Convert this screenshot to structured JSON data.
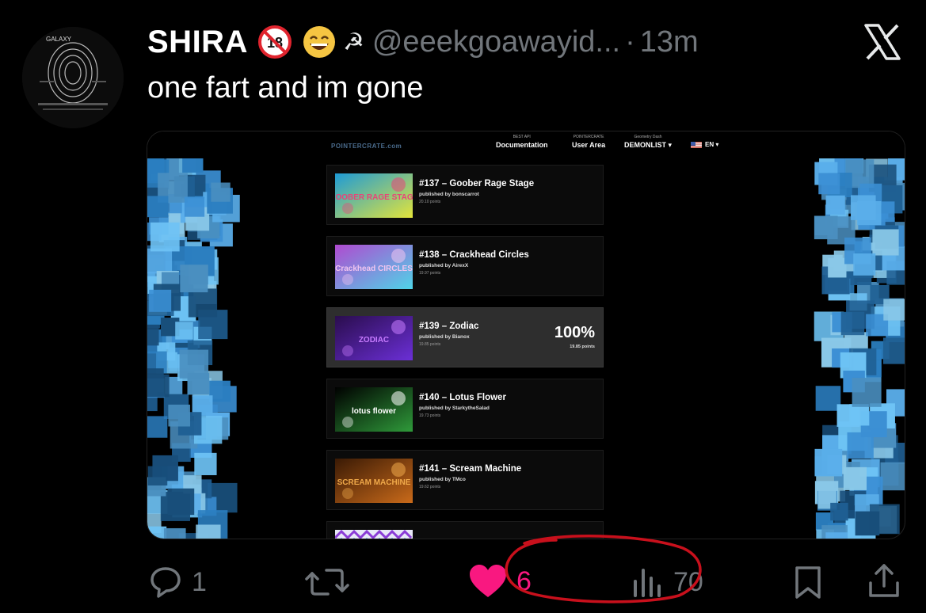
{
  "author": {
    "display_name": "SHIRA",
    "emojis": [
      "no-under-18-icon",
      "grinning-face-icon",
      "hammer-and-sickle-icon"
    ],
    "hammer_glyph": "☭",
    "handle": "@eeekgoawayid...",
    "separator": "·",
    "time": "13m",
    "avatar_text": "GALAXY"
  },
  "tweet": {
    "text": "one fart and im gone"
  },
  "media": {
    "site": {
      "logo": "POINTERCRATE.com",
      "nav": [
        {
          "small": "BEST API",
          "label": "Documentation"
        },
        {
          "small": "POINTERCRATE",
          "label": "User Area"
        },
        {
          "small": "Geometry Dash",
          "label": "DEMONLIST ▾"
        }
      ],
      "language": "EN ▾"
    },
    "levels": [
      {
        "title": "#137 – Goober Rage Stage",
        "publisher": "published by bonscarrot",
        "points": "20.10 points",
        "thumb_text": "GOOBER RAGE STAGE",
        "thumb_colors": [
          "#1e9bd6",
          "#e2e43b",
          "#e8437a"
        ]
      },
      {
        "title": "#138 – Crackhead Circles",
        "publisher": "published by AirexX",
        "points": "19.97 points",
        "thumb_text": "Crackhead CIRCLES",
        "thumb_colors": [
          "#b04ad0",
          "#4fd4e8",
          "#f2c4f0"
        ]
      },
      {
        "title": "#139 – Zodiac",
        "publisher": "published by Bianox",
        "points": "19.85 points",
        "thumb_text": "ZODIAC",
        "thumb_colors": [
          "#2a0d4d",
          "#6b2fd6",
          "#c77bff"
        ],
        "progress_label": "100%",
        "progress": 1.0,
        "highlight": true
      },
      {
        "title": "#140 – Lotus Flower",
        "publisher": "published by StarkytheSalad",
        "points": "19.73 points",
        "thumb_text": "lotus flower",
        "thumb_colors": [
          "#000000",
          "#2f9a3a",
          "#ffffff"
        ]
      },
      {
        "title": "#141 – Scream Machine",
        "publisher": "published by TMco",
        "points": "19.62 points",
        "thumb_text": "SCREAM MACHINE",
        "thumb_colors": [
          "#3a1a05",
          "#c96a1a",
          "#f0a94a"
        ]
      }
    ]
  },
  "actions": {
    "replies": "1",
    "retweets": "",
    "likes": "6",
    "views": "70"
  },
  "colors": {
    "like_pink": "#f91880",
    "muted": "#71767b",
    "annotation_red": "#c8101c"
  }
}
